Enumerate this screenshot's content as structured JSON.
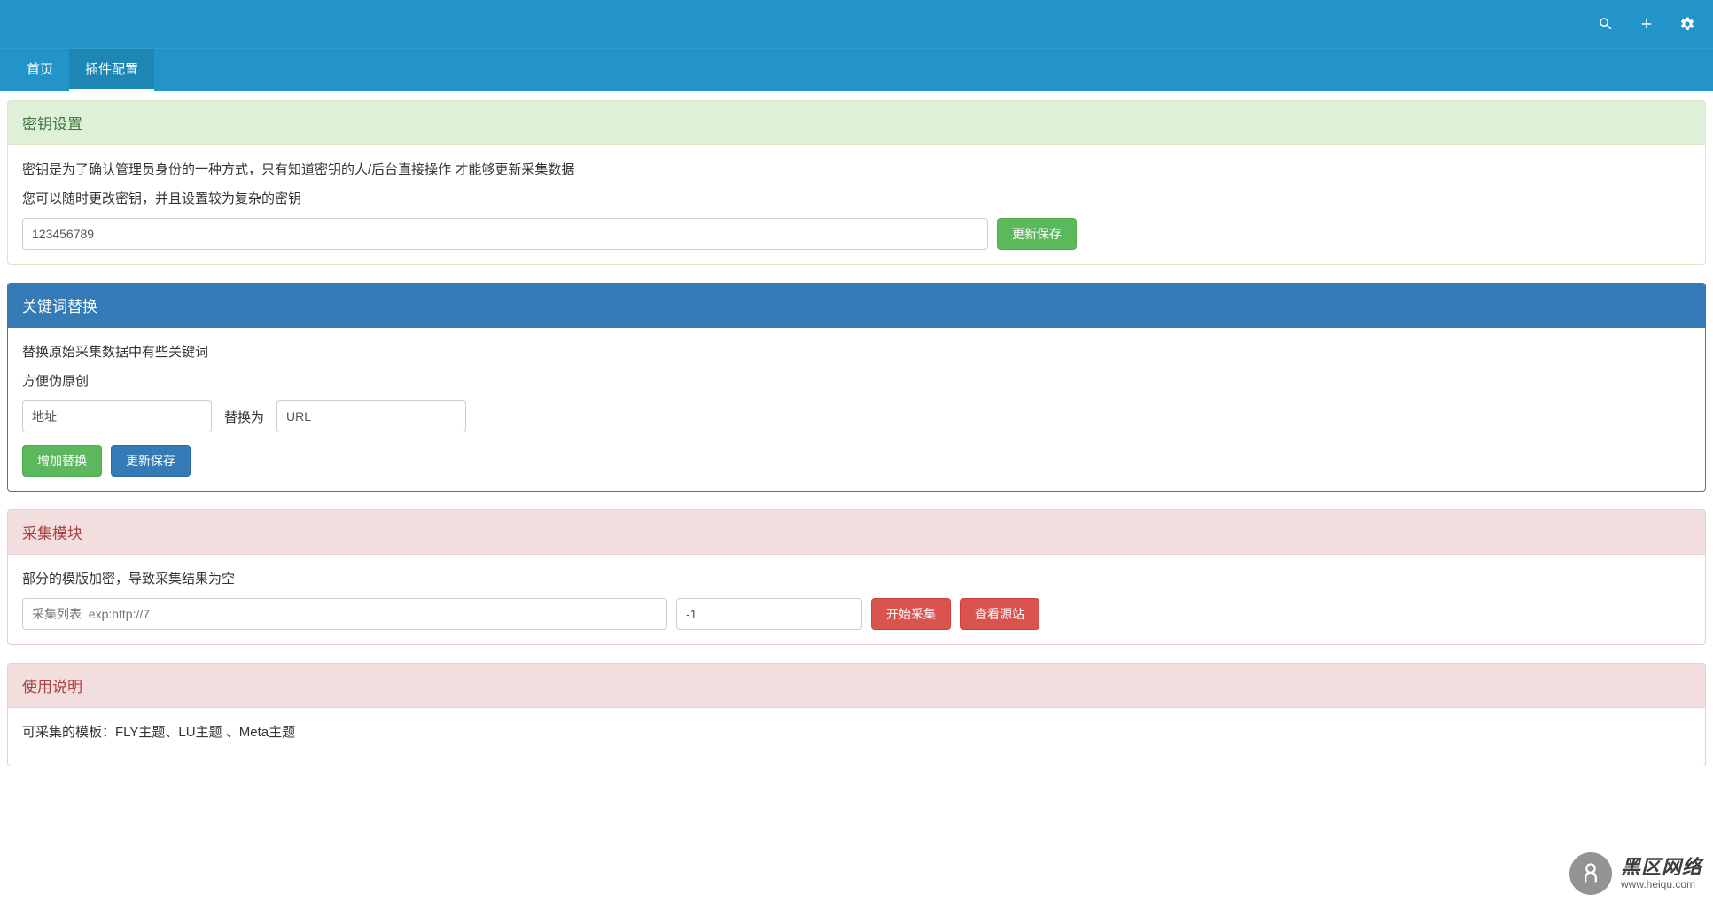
{
  "topbar": {
    "icons": [
      "search-icon",
      "plus-icon",
      "gear-icon"
    ]
  },
  "tabs": {
    "home": "首页",
    "plugin_config": "插件配置"
  },
  "secret": {
    "heading": "密钥设置",
    "desc1": "密钥是为了确认管理员身份的一种方式，只有知道密钥的人/后台直接操作 才能够更新采集数据",
    "desc2": "您可以随时更改密钥，并且设置较为复杂的密钥",
    "value": "123456789",
    "save_btn": "更新保存"
  },
  "keyword": {
    "heading": "关键词替换",
    "desc1": "替换原始采集数据中有些关键词",
    "desc2": "方便伪原创",
    "from_value": "地址",
    "label_replace_to": "替换为",
    "to_value": "URL",
    "add_btn": "增加替换",
    "save_btn": "更新保存"
  },
  "collect": {
    "heading": "采集模块",
    "desc1": "部分的模版加密，导致采集结果为空",
    "list_placeholder": "采集列表  exp:http://7",
    "num_value": "-1",
    "start_btn": "开始采集",
    "view_src_btn": "查看源站"
  },
  "usage": {
    "heading": "使用说明",
    "desc1": "可采集的模板：FLY主题、LU主题 、Meta主题"
  },
  "watermark": {
    "main": "黑区网络",
    "sub": "www.heiqu.com"
  }
}
